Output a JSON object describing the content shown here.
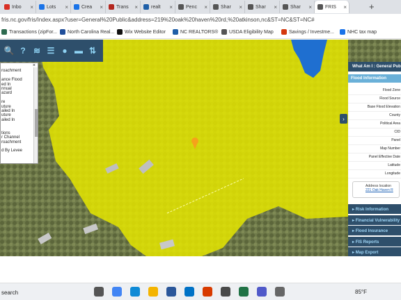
{
  "browser": {
    "tabs": [
      {
        "label": "Inbo",
        "color": "#d93025"
      },
      {
        "label": "Lots",
        "color": "#1a73e8"
      },
      {
        "label": "Crea",
        "color": "#1a73e8"
      },
      {
        "label": "Trans",
        "color": "#b3261e"
      },
      {
        "label": "realt",
        "color": "#1f5fa8"
      },
      {
        "label": "Penc",
        "color": "#555555"
      },
      {
        "label": "Shar",
        "color": "#555555"
      },
      {
        "label": "Shar",
        "color": "#555555"
      },
      {
        "label": "Shar",
        "color": "#555555"
      },
      {
        "label": "FRIS",
        "color": "#555555"
      }
    ],
    "url": "fris.nc.gov/fris/Index.aspx?user=General%20Public&address=219%20oak%20haven%20rd,%20atkinson,nc&ST=NC&ST=NC#",
    "bookmarks": [
      {
        "label": "Transactions (zipFor...",
        "color": "#2d6a4f"
      },
      {
        "label": "North Carolina Real...",
        "color": "#1f4e9a"
      },
      {
        "label": "Wix Website Editor",
        "color": "#111111"
      },
      {
        "label": "NC REALTORS®",
        "color": "#1f5fa8"
      },
      {
        "label": "USDA Eligibility Map",
        "color": "#555555"
      },
      {
        "label": "Savings / Investme...",
        "color": "#d4380d"
      },
      {
        "label": "NHC tax map",
        "color": "#1a73e8"
      }
    ]
  },
  "toolbar": {
    "icons": [
      "search-icon",
      "help-icon",
      "layers-icon",
      "list-icon",
      "bulb-icon",
      "ruler-icon",
      "coordinates-icon"
    ],
    "glyphs": [
      "🔍",
      "?",
      "≋",
      "☰",
      "●",
      "▬",
      "⇅"
    ]
  },
  "legend": {
    "lines": [
      "",
      "roachment",
      "",
      "ance Flood",
      "ed In",
      "nnual",
      "azard",
      "",
      "re",
      "uture",
      "ailed In",
      "uture",
      "ailed In",
      "",
      "",
      "tions",
      "r Channel",
      "roachment",
      "",
      "d By Levee"
    ]
  },
  "panel": {
    "title": "What Am I : General Public",
    "flood_section": "Flood Information",
    "fields": [
      "Flood Zone",
      "Flood Source",
      "Base Flood Elevation",
      "County",
      "Political Area",
      "CID",
      "Panel",
      "Map Number",
      "Panel Effective Date",
      "Latitude",
      "Longitude"
    ],
    "address_label": "Address location",
    "address_link": "221 Oak Haven R",
    "sections": [
      "Risk Information",
      "Financial Vulnerability",
      "Flood Insurance",
      "FIS Reports",
      "Map Export"
    ]
  },
  "taskbar": {
    "search": "search",
    "weather": "85°F",
    "apps": [
      {
        "name": "task-view-icon",
        "color": "#555555"
      },
      {
        "name": "chrome-icon",
        "color": "#4285f4"
      },
      {
        "name": "edge-icon",
        "color": "#0f8ad6"
      },
      {
        "name": "file-explorer-icon",
        "color": "#f4b400"
      },
      {
        "name": "word-icon",
        "color": "#2b579a"
      },
      {
        "name": "outlook-icon",
        "color": "#0072c6"
      },
      {
        "name": "calendar-icon",
        "color": "#d83b01"
      },
      {
        "name": "camera-icon",
        "color": "#4a4a4a"
      },
      {
        "name": "excel-icon",
        "color": "#217346"
      },
      {
        "name": "teams-icon",
        "color": "#5059c9"
      },
      {
        "name": "settings-icon",
        "color": "#666666"
      }
    ]
  }
}
